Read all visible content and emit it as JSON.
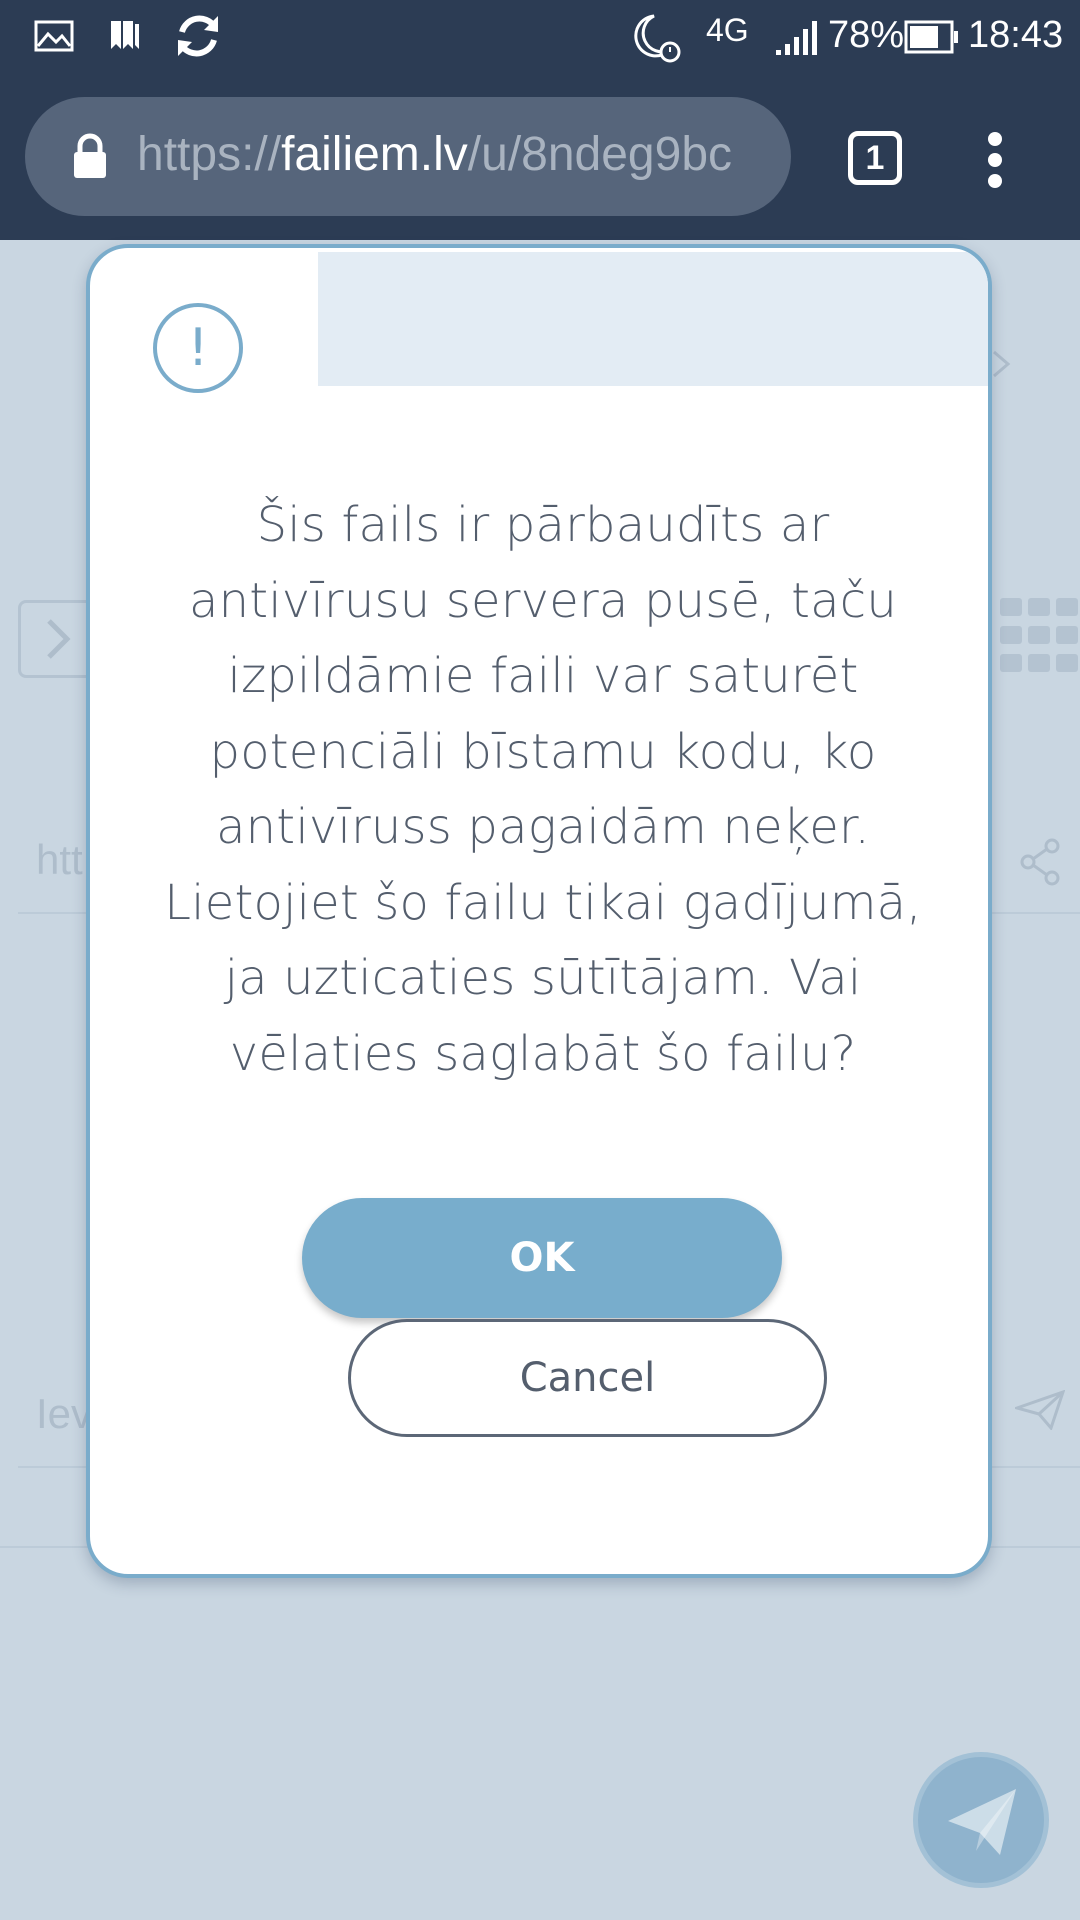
{
  "status_bar": {
    "network": "4G",
    "battery_percent": "78%",
    "time": "18:43",
    "left_icons": [
      "gallery-icon",
      "bookmarks-icon",
      "sync-icon"
    ],
    "right_icons": [
      "night-alarm-icon",
      "signal-icon",
      "battery-icon"
    ]
  },
  "browser": {
    "url_scheme": "https://",
    "url_host": "failiem.lv",
    "url_path": "/u/8ndeg9bc",
    "tab_count": "1"
  },
  "background_page": {
    "link_text_partial": "htt",
    "input_placeholder_partial": "Iev"
  },
  "dialog": {
    "icon": "alert-icon",
    "message": "Šis fails ir pārbaudīts ar antivīrusu servera pusē, taču izpildāmie faili var saturēt potenciāli bīstamu kodu, ko antivīruss pagaidām neķer. Lietojiet šo failu tikai gadījumā, ja uzticaties sūtītājam. Vai vēlaties saglabāt šo failu?",
    "ok_label": "OK",
    "cancel_label": "Cancel"
  },
  "colors": {
    "top_bar": "#2c3c54",
    "accent": "#78adcc",
    "dialog_text": "#545e6d",
    "page_bg": "#c9d6e1"
  }
}
